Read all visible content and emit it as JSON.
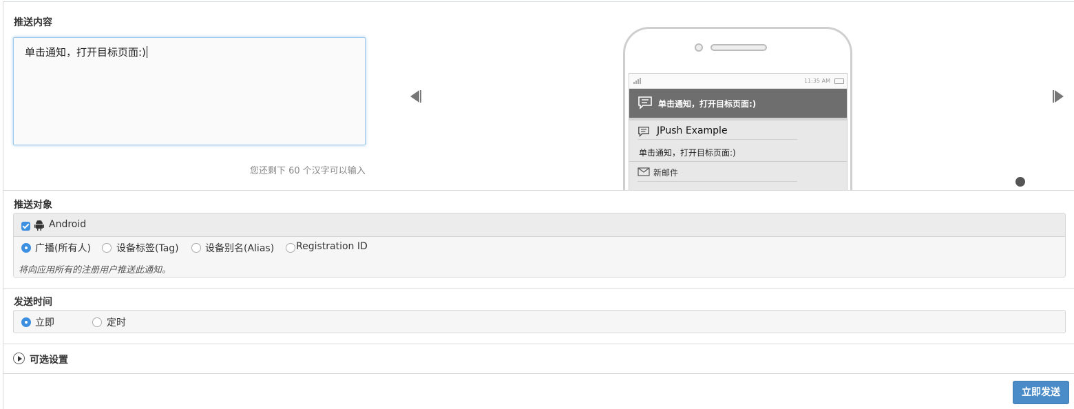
{
  "content_section": {
    "title": "推送内容",
    "message": "单击通知，打开目标页面:)",
    "remaining_hint": "您还剩下 60 个汉字可以输入"
  },
  "preview": {
    "status_time": "11:35 AM",
    "notification_bar_text": "单击通知，打开目标页面:)",
    "app_title": "JPush Example",
    "app_message": "单击通知，打开目标页面:)",
    "mail_item": "新邮件",
    "icons": [
      "chat-bubble-icon",
      "mail-icon",
      "prev-arrow-icon",
      "next-arrow-icon"
    ]
  },
  "target_section": {
    "title": "推送对象",
    "platform": "Android",
    "platform_checked": true,
    "options": [
      {
        "label": "广播(所有人)",
        "selected": true
      },
      {
        "label": "设备标签(Tag)",
        "selected": false
      },
      {
        "label": "设备别名(Alias)",
        "selected": false
      },
      {
        "label": "Registration ID",
        "selected": false
      }
    ],
    "hint": "将向应用所有的注册用户推送此通知。"
  },
  "time_section": {
    "title": "发送时间",
    "options": [
      {
        "label": "立即",
        "selected": true
      },
      {
        "label": "定时",
        "selected": false
      }
    ]
  },
  "optional_section": {
    "title": "可选设置"
  },
  "actions": {
    "send_label": "立即发送"
  },
  "colors": {
    "accent": "#3d8fe0",
    "button": "#4a8cc7",
    "notification_bar": "#6e6e6e"
  }
}
